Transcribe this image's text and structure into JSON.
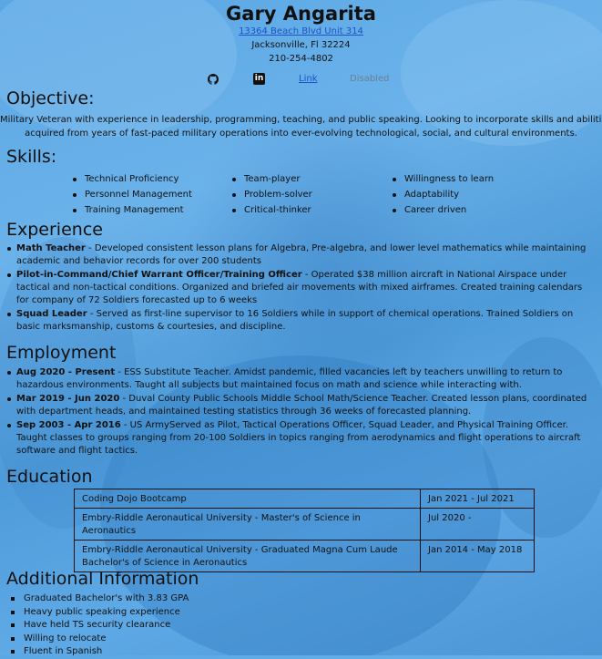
{
  "header": {
    "name": "Gary Angarita",
    "address": "13364 Beach Blvd Unit 314",
    "city": "Jacksonville, Fl 32224",
    "phone": "210-254-4802"
  },
  "links": {
    "github_icon": "github-icon",
    "linkedin_icon": "linkedin-icon",
    "linkedin_glyph": "in",
    "link_label": "Link",
    "disabled_label": "Disabled"
  },
  "objective": {
    "title": "Objective:",
    "line1": "Military Veteran with experience in leadership, programming, teaching, and public speaking. Looking to incorporate skills and abilities",
    "line2": "acquired from years of fast-paced military operations into ever-evolving technological, social, and cultural environments."
  },
  "skills": {
    "title": "Skills:",
    "col1": [
      "Technical Proficiency",
      "Personnel Management",
      "Training Management"
    ],
    "col2": [
      "Team-player",
      "Problem-solver",
      "Critical-thinker"
    ],
    "col3": [
      "Willingness to learn",
      "Adaptability",
      "Career driven"
    ]
  },
  "experience": {
    "title": "Experience",
    "items": [
      {
        "role": "Math Teacher",
        "text": " - Developed consistent lesson plans for Algebra, Pre-algebra, and lower level mathematics while maintaining academic and behavior records for over 200 students"
      },
      {
        "role": "Pilot-in-Command/Chief Warrant Officer/Training Officer",
        "text": " - Operated $38 million aircraft in National Airspace under tactical and non-tactical conditions. Organized and briefed air movements with mixed airframes. Created training calendars for company of 72 Soldiers forecasted up to 6 weeks"
      },
      {
        "role": "Squad Leader",
        "text": " - Served as first-line supervisor to 16 Soldiers while in support of chemical operations. Trained Soldiers on basic marksmanship, customs & courtesies, and discipline."
      }
    ]
  },
  "employment": {
    "title": "Employment",
    "items": [
      {
        "dates": "Aug 2020 - Present",
        "text": " - ESS Substitute Teacher. Amidst pandemic, filled vacancies left by teachers unwilling to return to hazardous environments. Taught all subjects but maintained focus on math and science while interacting with."
      },
      {
        "dates": "Mar 2019 - Jun 2020",
        "text": " - Duval County Public Schools Middle School Math/Science Teacher. Created lesson plans, coordinated with department heads, and maintained testing statistics through 36 weeks of forecasted planning."
      },
      {
        "dates": "Sep 2003 - Apr 2016",
        "text": " - US ArmyServed as Pilot, Tactical Operations Officer, Squad Leader, and Physical Training Officer. Taught classes to groups ranging from 20-100 Soldiers in topics ranging from aerodynamics and flight operations to aircraft software and flight tactics."
      }
    ]
  },
  "education": {
    "title": "Education",
    "rows": [
      {
        "school": "Coding Dojo Bootcamp",
        "dates": "Jan 2021 - Jul 2021"
      },
      {
        "school": "Embry-Riddle Aeronautical University - Master's of Science in Aeronautics",
        "dates": "Jul 2020 -"
      },
      {
        "school": "Embry-Riddle Aeronautical University - Graduated Magna Cum Laude Bachelor's of Science in Aeronautics",
        "dates": "Jan 2014 - May 2018"
      }
    ]
  },
  "additional": {
    "title": "Additional Information",
    "items": [
      "Graduated Bachelor's with 3.83 GPA",
      "Heavy public speaking experience",
      "Have held TS security clearance",
      "Willing to relocate",
      "Fluent in Spanish"
    ]
  }
}
